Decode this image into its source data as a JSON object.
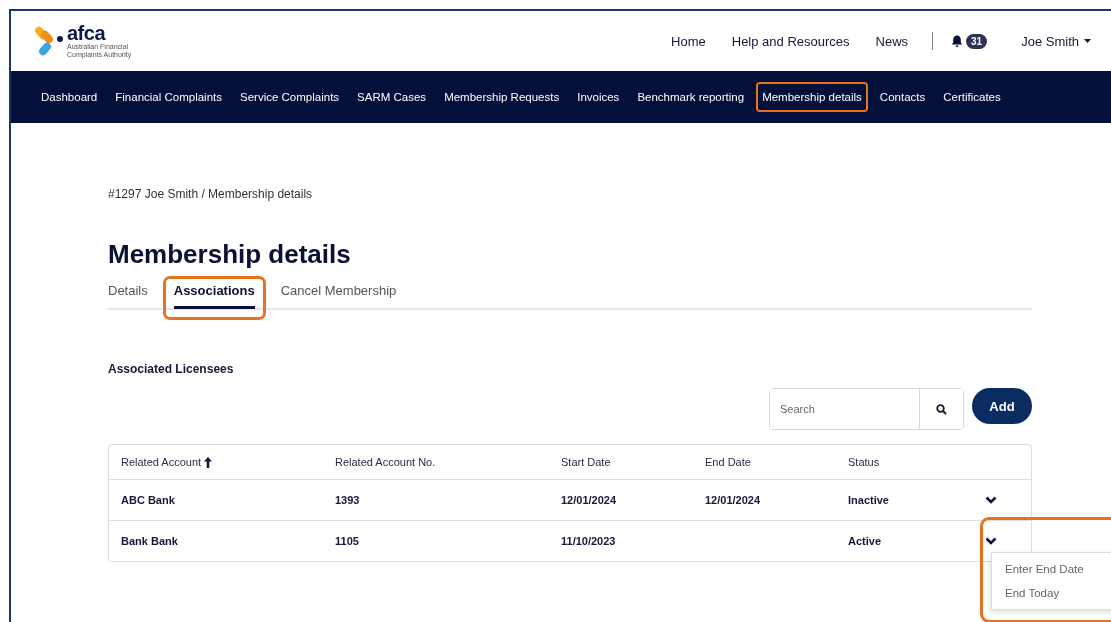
{
  "logo": {
    "wordmark": "afca",
    "tagline": "Australian Financial Complaints Authority"
  },
  "top_links": [
    {
      "label": "Home"
    },
    {
      "label": "Help and Resources"
    },
    {
      "label": "News"
    }
  ],
  "notifications": {
    "count": "31"
  },
  "user": {
    "name": "Joe Smith"
  },
  "nav": [
    {
      "label": "Dashboard",
      "highlighted": false
    },
    {
      "label": "Financial Complaints",
      "highlighted": false
    },
    {
      "label": "Service Complaints",
      "highlighted": false
    },
    {
      "label": "SARM Cases",
      "highlighted": false
    },
    {
      "label": "Membership Requests",
      "highlighted": false
    },
    {
      "label": "Invoices",
      "highlighted": false
    },
    {
      "label": "Benchmark reporting",
      "highlighted": false
    },
    {
      "label": "Membership details",
      "highlighted": true
    },
    {
      "label": "Contacts",
      "highlighted": false
    },
    {
      "label": "Certificates",
      "highlighted": false
    }
  ],
  "breadcrumb": "#1297 Joe Smith / Membership details",
  "title": "Membership details",
  "tabs": [
    {
      "label": "Details",
      "selected": false,
      "highlighted": false
    },
    {
      "label": "Associations",
      "selected": true,
      "highlighted": true
    },
    {
      "label": "Cancel Membership",
      "selected": false,
      "highlighted": false
    }
  ],
  "section_title": "Associated Licensees",
  "search": {
    "placeholder": "Search"
  },
  "add_button": "Add",
  "table": {
    "columns": [
      {
        "label": "Related Account",
        "sorted": true
      },
      {
        "label": "Related Account No.",
        "sorted": false
      },
      {
        "label": "Start Date",
        "sorted": false
      },
      {
        "label": "End Date",
        "sorted": false
      },
      {
        "label": "Status",
        "sorted": false
      }
    ],
    "rows": [
      {
        "cells": [
          "ABC Bank",
          "1393",
          "12/01/2024",
          "12/01/2024",
          "Inactive"
        ],
        "highlighted": false
      },
      {
        "cells": [
          "Bank Bank",
          "1105",
          "11/10/2023",
          "",
          "Active"
        ],
        "highlighted": true,
        "menu": [
          "Enter End Date",
          "End Today"
        ]
      }
    ]
  }
}
